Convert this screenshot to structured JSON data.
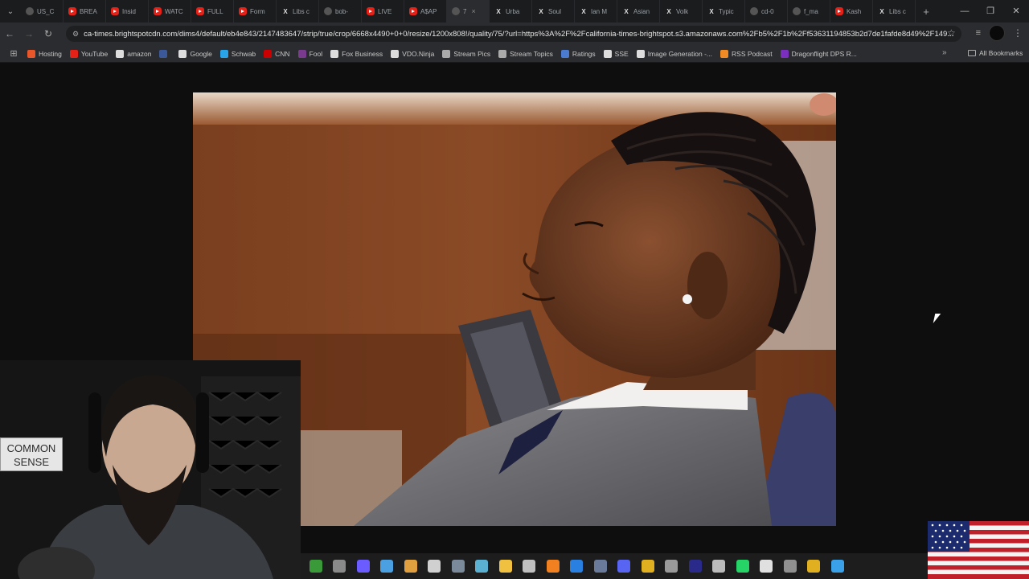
{
  "browser": {
    "tabs": [
      {
        "label": "US_C",
        "icon": "globe"
      },
      {
        "label": "BREA",
        "icon": "youtube"
      },
      {
        "label": "Insid",
        "icon": "youtube"
      },
      {
        "label": "WATC",
        "icon": "youtube"
      },
      {
        "label": "FULL",
        "icon": "youtube"
      },
      {
        "label": "Form",
        "icon": "youtube"
      },
      {
        "label": "Libs c",
        "icon": "x"
      },
      {
        "label": "bob-",
        "icon": "page"
      },
      {
        "label": "LIVE",
        "icon": "youtube"
      },
      {
        "label": "A$AP",
        "icon": "youtube"
      },
      {
        "label": "7",
        "icon": "circle",
        "active": true,
        "close": "×"
      },
      {
        "label": "Urba",
        "icon": "x"
      },
      {
        "label": "Soul",
        "icon": "x"
      },
      {
        "label": "Ian M",
        "icon": "x"
      },
      {
        "label": "Asian",
        "icon": "x"
      },
      {
        "label": "Volk",
        "icon": "x"
      },
      {
        "label": "Typic",
        "icon": "x"
      },
      {
        "label": "cd-0",
        "icon": "circle"
      },
      {
        "label": "f_ma",
        "icon": "page"
      },
      {
        "label": "Kash",
        "icon": "youtube"
      },
      {
        "label": "Libs c",
        "icon": "x"
      }
    ],
    "new_tab": "+",
    "window_controls": {
      "minimize": "—",
      "restore": "❐",
      "close": "✕"
    },
    "url": "ca-times.brightspotcdn.com/dims4/default/eb4e843/2147483647/strip/true/crop/6668x4490+0+0/resize/1200x808!/quality/75/?url=https%3A%2F%2Fcalifornia-times-brightspot.s3.amazonaws.com%2Fb5%2F1b%2Ff53631194853b2d7de1fafde8d49%2F149...",
    "bookmarks": [
      {
        "label": "Hosting",
        "color": "#e8562a"
      },
      {
        "label": "YouTube",
        "color": "#e62117"
      },
      {
        "label": "amazon",
        "color": "#dddddd"
      },
      {
        "label": "",
        "color": "#3b5998"
      },
      {
        "label": "Google",
        "color": "#dddddd"
      },
      {
        "label": "Schwab",
        "color": "#2aa4e8"
      },
      {
        "label": "CNN",
        "color": "#cc0000"
      },
      {
        "label": "Fool",
        "color": "#7a3b8f"
      },
      {
        "label": "Fox Business",
        "color": "#dddddd"
      },
      {
        "label": "VDO.Ninja",
        "color": "#dddddd"
      },
      {
        "label": "Stream Pics",
        "color": "#aaaaaa"
      },
      {
        "label": "Stream Topics",
        "color": "#aaaaaa"
      },
      {
        "label": "Ratings",
        "color": "#4a7bd0"
      },
      {
        "label": "SSE",
        "color": "#dddddd"
      },
      {
        "label": "Image Generation -...",
        "color": "#dddddd"
      },
      {
        "label": "RSS Podcast",
        "color": "#f08a24"
      },
      {
        "label": "Dragonflight DPS R...",
        "color": "#7b2fbf"
      }
    ],
    "all_bookmarks": "All Bookmarks",
    "more": "»"
  },
  "overlay": {
    "sign_text_line1": "COMMON",
    "sign_text_line2": "SENSE"
  },
  "taskbar": {
    "apps": [
      {
        "name": "frog",
        "color": "#3a9a3a"
      },
      {
        "name": "files",
        "color": "#8a8a8a"
      },
      {
        "name": "copilot",
        "color": "#6a5cff"
      },
      {
        "name": "photos",
        "color": "#4aa0e0"
      },
      {
        "name": "notepad",
        "color": "#e0a040"
      },
      {
        "name": "pinwheel",
        "color": "#d0d0d0"
      },
      {
        "name": "settings",
        "color": "#7a8a9a"
      },
      {
        "name": "headset",
        "color": "#5ab0d0"
      },
      {
        "name": "explorer",
        "color": "#f0c040"
      },
      {
        "name": "disc",
        "color": "#c0c0c0"
      },
      {
        "name": "vlc",
        "color": "#f08020"
      },
      {
        "name": "edge",
        "color": "#2a80e0"
      },
      {
        "name": "steam",
        "color": "#6a7a9a"
      },
      {
        "name": "discord",
        "color": "#5865f2"
      },
      {
        "name": "chrome",
        "color": "#e0b020"
      },
      {
        "name": "calendar",
        "color": "#9a9a9a"
      },
      {
        "name": "premiere",
        "color": "#2a2a8a"
      },
      {
        "name": "stream-deck",
        "color": "#bbbbbb"
      },
      {
        "name": "whatsapp",
        "color": "#25d366"
      },
      {
        "name": "capcut",
        "color": "#e0e0e0"
      },
      {
        "name": "obs",
        "color": "#909090"
      },
      {
        "name": "chrome-2",
        "color": "#e0b020"
      },
      {
        "name": "paint",
        "color": "#3aa0e8"
      }
    ]
  }
}
